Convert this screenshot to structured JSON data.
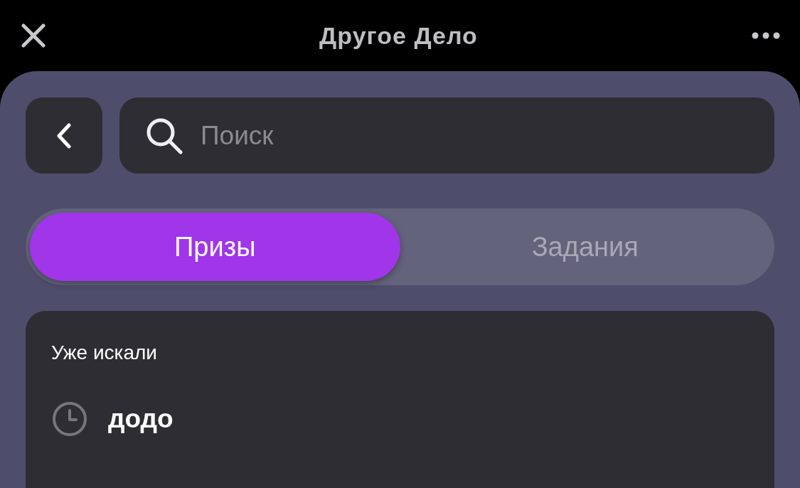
{
  "window": {
    "title": "Другое Дело"
  },
  "search": {
    "placeholder": "Поиск"
  },
  "tabs": [
    {
      "label": "Призы",
      "selected": true
    },
    {
      "label": "Задания",
      "selected": false
    }
  ],
  "recent": {
    "title": "Уже искали",
    "items": [
      {
        "text": "додо"
      }
    ]
  }
}
